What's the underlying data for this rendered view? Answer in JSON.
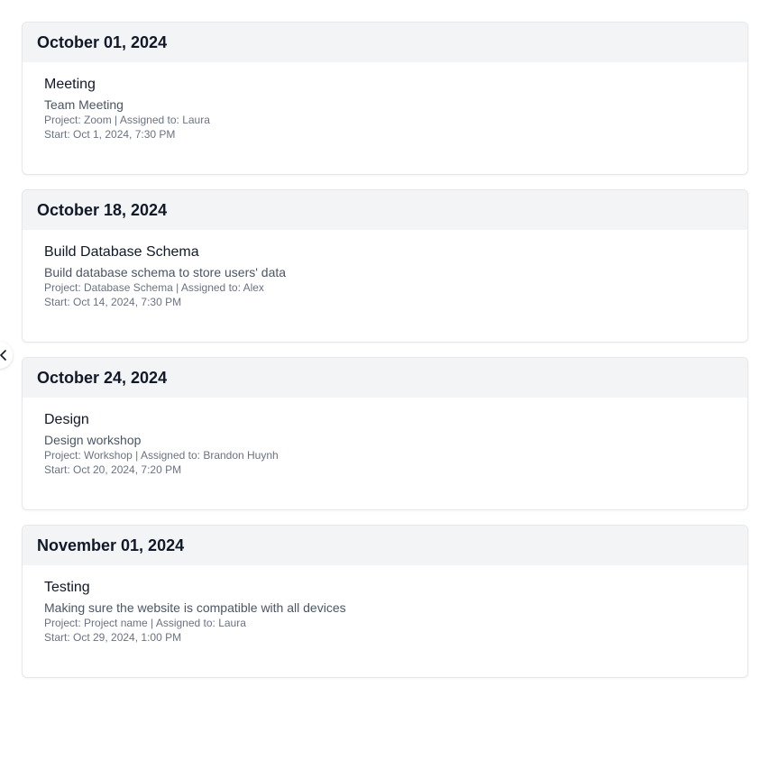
{
  "groups": [
    {
      "date": "October 01, 2024",
      "event": {
        "title": "Meeting",
        "description": "Team Meeting",
        "meta": "Project: Zoom | Assigned to: Laura",
        "start": "Start: Oct 1, 2024, 7:30 PM"
      }
    },
    {
      "date": "October 18, 2024",
      "event": {
        "title": "Build Database Schema",
        "description": "Build database schema to store users' data",
        "meta": "Project: Database Schema | Assigned to: Alex",
        "start": "Start: Oct 14, 2024, 7:30 PM"
      }
    },
    {
      "date": "October 24, 2024",
      "event": {
        "title": "Design",
        "description": "Design workshop",
        "meta": "Project: Workshop | Assigned to: Brandon Huynh",
        "start": "Start: Oct 20, 2024, 7:20 PM"
      }
    },
    {
      "date": "November 01, 2024",
      "event": {
        "title": "Testing",
        "description": "Making sure the website is compatible with all devices",
        "meta": "Project: Project name | Assigned to: Laura",
        "start": "Start: Oct 29, 2024, 1:00 PM"
      }
    }
  ],
  "toggle": {
    "icon": "chevron-left-icon"
  }
}
